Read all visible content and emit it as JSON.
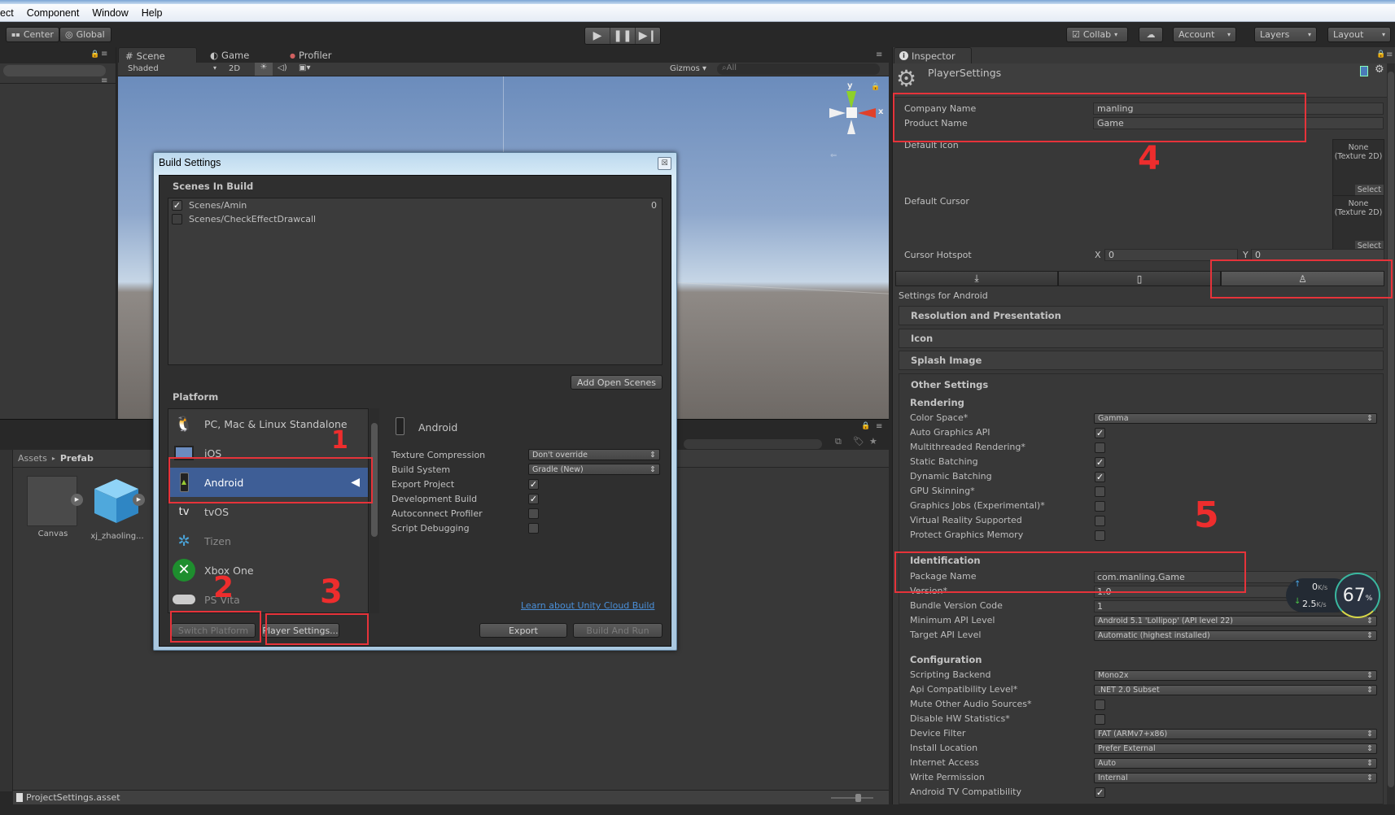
{
  "menu": [
    "ect",
    "Component",
    "Window",
    "Help"
  ],
  "toolbar": {
    "pivot": "Center",
    "space": "Global",
    "collab": "Collab",
    "account": "Account",
    "layers": "Layers",
    "layout": "Layout"
  },
  "scene_tabs": [
    {
      "label": "Scene",
      "icon": "grid-icon"
    },
    {
      "label": "Game",
      "icon": "pacman-icon"
    },
    {
      "label": "Profiler",
      "icon": "profiler-icon"
    }
  ],
  "scene_bar": {
    "shading": "Shaded",
    "mode2d": "2D",
    "gizmos": "Gizmos",
    "search_placeholder": "All"
  },
  "gizmo": {
    "y": "y",
    "x": "x"
  },
  "project": {
    "breadcrumb_root": "Assets",
    "breadcrumb_current": "Prefab",
    "assets": [
      {
        "name": "Canvas",
        "type": "prefab-empty"
      },
      {
        "name": "xj_zhaoling...",
        "type": "prefab-cube"
      }
    ],
    "status_file": "ProjectSettings.asset"
  },
  "build_settings": {
    "title": "Build Settings",
    "close": "☒",
    "scenes_header": "Scenes In Build",
    "scenes": [
      {
        "name": "Scenes/Amin",
        "checked": true,
        "index": "0"
      },
      {
        "name": "Scenes/CheckEffectDrawcall",
        "checked": false,
        "index": ""
      }
    ],
    "add_open_scenes": "Add Open Scenes",
    "platform_header": "Platform",
    "platforms": [
      {
        "name": "PC, Mac & Linux Standalone",
        "icon": "standalone-icon",
        "selected": false
      },
      {
        "name": "iOS",
        "icon": "ios-icon",
        "selected": false
      },
      {
        "name": "Android",
        "icon": "android-icon",
        "selected": true
      },
      {
        "name": "tvOS",
        "icon": "appletv-icon",
        "selected": false
      },
      {
        "name": "Tizen",
        "icon": "tizen-icon",
        "selected": false
      },
      {
        "name": "Xbox One",
        "icon": "xbox-icon",
        "selected": false
      },
      {
        "name": "PS Vita",
        "icon": "psvita-icon",
        "selected": false
      }
    ],
    "selected_platform": "Android",
    "options": [
      {
        "label": "Texture Compression",
        "type": "dropdown",
        "value": "Don't override"
      },
      {
        "label": "Build System",
        "type": "dropdown",
        "value": "Gradle (New)"
      },
      {
        "label": "Export Project",
        "type": "checkbox",
        "checked": true
      },
      {
        "label": "Development Build",
        "type": "checkbox",
        "checked": true
      },
      {
        "label": "Autoconnect Profiler",
        "type": "checkbox",
        "checked": false
      },
      {
        "label": "Script Debugging",
        "type": "checkbox",
        "checked": false
      }
    ],
    "cloud_link": "Learn about Unity Cloud Build",
    "switch_platform": "Switch Platform",
    "player_settings": "Player Settings...",
    "export": "Export",
    "build_and_run": "Build And Run"
  },
  "inspector": {
    "tab": "Inspector",
    "title": "PlayerSettings",
    "company_label": "Company Name",
    "company_value": "manling",
    "product_label": "Product Name",
    "product_value": "Game",
    "default_icon_label": "Default Icon",
    "default_cursor_label": "Default Cursor",
    "texture_none": "None (Texture 2D)",
    "select": "Select",
    "cursor_hotspot_label": "Cursor Hotspot",
    "hotspot_x_label": "X",
    "hotspot_x": "0",
    "hotspot_y_label": "Y",
    "hotspot_y": "0",
    "platform_tabs": [
      "standalone-icon",
      "mobile-icon",
      "android-icon"
    ],
    "settings_for": "Settings for Android",
    "foldouts": [
      "Resolution and Presentation",
      "Icon",
      "Splash Image",
      "Other Settings"
    ],
    "rendering_header": "Rendering",
    "rendering": [
      {
        "label": "Color Space*",
        "type": "dropdown",
        "value": "Gamma"
      },
      {
        "label": "Auto Graphics API",
        "type": "checkbox",
        "checked": true
      },
      {
        "label": "Multithreaded Rendering*",
        "type": "checkbox",
        "checked": false
      },
      {
        "label": "Static Batching",
        "type": "checkbox",
        "checked": true
      },
      {
        "label": "Dynamic Batching",
        "type": "checkbox",
        "checked": true
      },
      {
        "label": "GPU Skinning*",
        "type": "checkbox",
        "checked": false
      },
      {
        "label": "Graphics Jobs (Experimental)*",
        "type": "checkbox",
        "checked": false
      },
      {
        "label": "Virtual Reality Supported",
        "type": "checkbox",
        "checked": false
      },
      {
        "label": "Protect Graphics Memory",
        "type": "checkbox",
        "checked": false
      }
    ],
    "identification_header": "Identification",
    "identification": [
      {
        "label": "Package Name",
        "type": "text",
        "value": "com.manling.Game"
      },
      {
        "label": "Version*",
        "type": "text",
        "value": "1.0"
      },
      {
        "label": "Bundle Version Code",
        "type": "text",
        "value": "1"
      },
      {
        "label": "Minimum API Level",
        "type": "dropdown",
        "value": "Android 5.1 'Lollipop' (API level 22)"
      },
      {
        "label": "Target API Level",
        "type": "dropdown",
        "value": "Automatic (highest installed)"
      }
    ],
    "configuration_header": "Configuration",
    "configuration": [
      {
        "label": "Scripting Backend",
        "type": "dropdown",
        "value": "Mono2x"
      },
      {
        "label": "Api Compatibility Level*",
        "type": "dropdown",
        "value": ".NET 2.0 Subset"
      },
      {
        "label": "Mute Other Audio Sources*",
        "type": "checkbox",
        "checked": false
      },
      {
        "label": "Disable HW Statistics*",
        "type": "checkbox",
        "checked": false
      },
      {
        "label": "Device Filter",
        "type": "dropdown",
        "value": "FAT (ARMv7+x86)"
      },
      {
        "label": "Install Location",
        "type": "dropdown",
        "value": "Prefer External"
      },
      {
        "label": "Internet Access",
        "type": "dropdown",
        "value": "Auto"
      },
      {
        "label": "Write Permission",
        "type": "dropdown",
        "value": "Internal"
      },
      {
        "label": "Android TV Compatibility",
        "type": "checkbox",
        "checked": true
      }
    ]
  },
  "net_widget": {
    "upload": "0",
    "download": "2.5",
    "unit": "K/s",
    "percent": "67",
    "percent_sign": "%"
  },
  "annotations": [
    "1",
    "2",
    "3",
    "4",
    "5"
  ],
  "colors": {
    "selection": "#3e5e96",
    "annotation_red": "#e6333a",
    "link": "#4a8fd8"
  }
}
